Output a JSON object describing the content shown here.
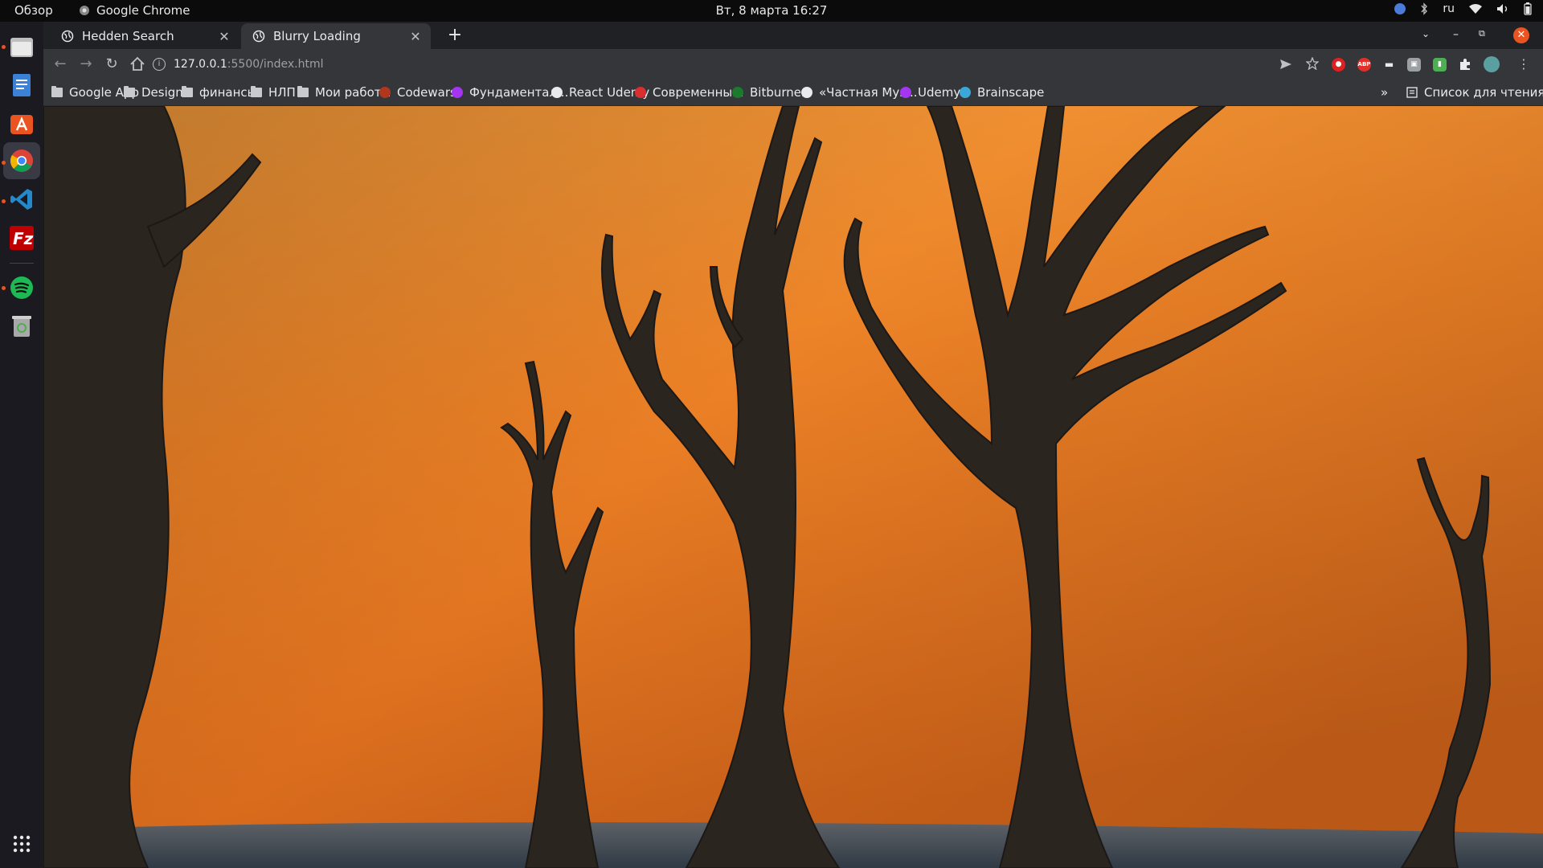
{
  "topbar": {
    "activities": "Обзор",
    "app_name": "Google Chrome",
    "datetime": "Вт, 8 марта  16:27",
    "lang": "ru"
  },
  "dock": {
    "items": [
      "files",
      "text-editor",
      "software-center",
      "chrome",
      "vscode",
      "filezilla",
      "spotify",
      "trash",
      "app-grid"
    ]
  },
  "browser": {
    "tabs": [
      {
        "title": "Hedden Search",
        "active": false
      },
      {
        "title": "Blurry Loading",
        "active": true
      }
    ],
    "new_tab": "+",
    "url_host": "127.0.0.1",
    "url_path": ":5500/index.html",
    "bookmarks": [
      {
        "label": "Google App",
        "icon": "folder"
      },
      {
        "label": "Design",
        "icon": "folder"
      },
      {
        "label": "финансы",
        "icon": "folder"
      },
      {
        "label": "НЛП",
        "icon": "folder"
      },
      {
        "label": "Мои работы",
        "icon": "folder"
      },
      {
        "label": "Codewars",
        "icon": "codewars"
      },
      {
        "label": "Фундаментал...",
        "icon": "udemy"
      },
      {
        "label": "React Udemy",
        "icon": "globe"
      },
      {
        "label": "Современны...",
        "icon": "js"
      },
      {
        "label": "Bitburner",
        "icon": "bitburner"
      },
      {
        "label": "«Частная Муз...",
        "icon": "music"
      },
      {
        "label": "Udemy",
        "icon": "udemy"
      },
      {
        "label": "Brainscape",
        "icon": "brainscape"
      }
    ],
    "more": "»",
    "reading_list": "Список для чтения"
  },
  "colors": {
    "accent": "#e95420",
    "sky_top": "#ee8a2a",
    "sky_bottom": "#d9651a",
    "ground": "#3d4752",
    "tree": "#2a2420"
  }
}
